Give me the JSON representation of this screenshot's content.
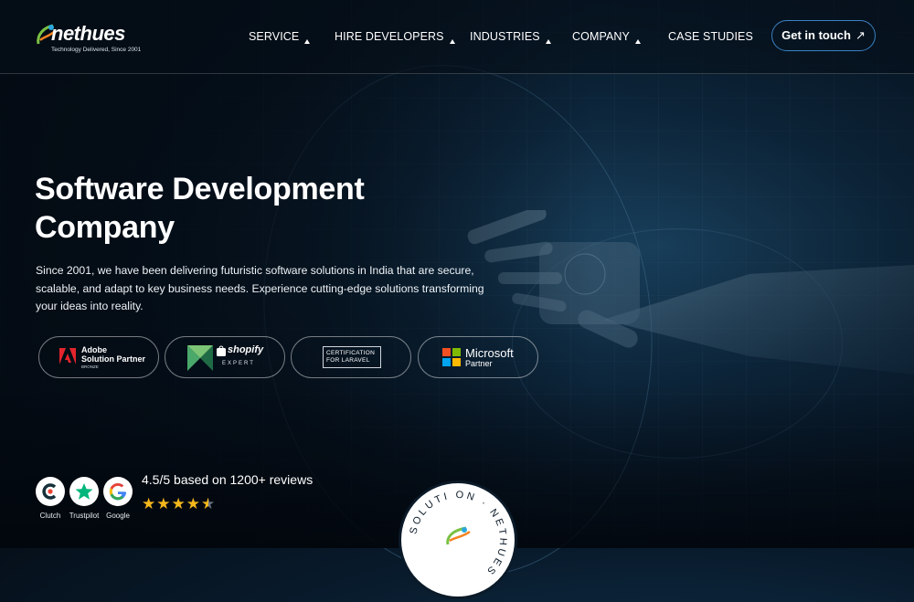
{
  "header": {
    "logo": {
      "name": "nethues",
      "tagline": "Technology Delivered, Since 2001"
    },
    "nav": [
      {
        "label": "SERVICE",
        "has_dropdown": true
      },
      {
        "label": "HIRE DEVELOPERS",
        "has_dropdown": true
      },
      {
        "label": "INDUSTRIES",
        "has_dropdown": true
      },
      {
        "label": "COMPANY",
        "has_dropdown": true
      },
      {
        "label": "CASE STUDIES",
        "has_dropdown": false
      }
    ],
    "cta_label": "Get in touch",
    "cta_icon": "arrow-up-right-icon"
  },
  "hero": {
    "title_line1": "Software Development",
    "title_line2": "Company",
    "description": "Since 2001, we have been delivering futuristic software solutions in India that are secure, scalable, and adapt to key business needs. Experience cutting-edge solutions transforming your ideas into reality."
  },
  "badges": [
    {
      "name": "Adobe",
      "line1": "Adobe",
      "line2": "Solution Partner",
      "line3": "BRONZE",
      "icon": "adobe-icon"
    },
    {
      "name": "Shopify",
      "line1": "shopify",
      "line2": "EXPERT",
      "icon": "shopify-icon"
    },
    {
      "name": "Laravel",
      "line1": "CERTIFICATION",
      "line2": "FOR LARAVEL",
      "icon": "laravel-certification-icon"
    },
    {
      "name": "Microsoft",
      "line1": "Microsoft",
      "line2": "Partner",
      "icon": "microsoft-icon"
    }
  ],
  "reviews": {
    "summary": "4.5/5 based on 1200+ reviews",
    "rating": 4.5,
    "max_rating": 5,
    "platforms": [
      {
        "label": "Clutch",
        "icon": "clutch-icon"
      },
      {
        "label": "Trustpilot",
        "icon": "trustpilot-icon"
      },
      {
        "label": "Google",
        "icon": "google-icon"
      }
    ]
  },
  "stamp": {
    "text": "SOLUTI ON · NETHUES"
  },
  "colors": {
    "accent_blue": "#3a82c4",
    "star": "#f5b81c",
    "background": "#081a2b"
  }
}
